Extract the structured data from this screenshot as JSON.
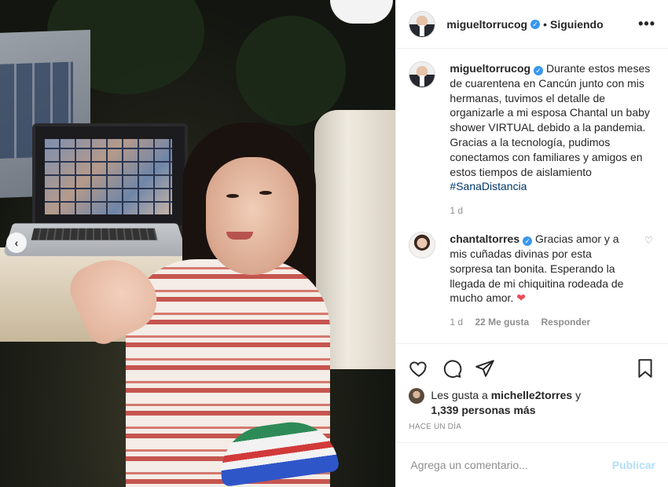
{
  "post": {
    "username": "migueltorrucog",
    "follow_status": "Siguiendo",
    "separator": "•",
    "more_icon": "•••"
  },
  "photo": {
    "prev_icon": "‹"
  },
  "caption": {
    "username": "migueltorrucog",
    "text": "Durante estos meses de cuarentena en Cancún junto con mis hermanas, tuvimos el detalle de organizarle a mi esposa Chantal un baby shower VIRTUAL debido a la pandemia. Gracias a la tecnología, pudimos conectamos con familiares y amigos en estos tiempos de aislamiento ",
    "hashtag": "#SanaDistancia",
    "time": "1 d"
  },
  "comment": {
    "username": "chantaltorres",
    "text": "Gracias amor y a mis cuñadas divinas por esta sorpresa tan bonita. Esperando la llegada de mi chiquitina rodeada de mucho amor. ",
    "emoji": "❤",
    "time": "1 d",
    "likes": "22 Me gusta",
    "reply": "Responder",
    "like_icon": "♡"
  },
  "likes": {
    "prefix": "Les gusta a ",
    "user": "michelle2torres",
    "middle": " y",
    "others": "1,339 personas más"
  },
  "timestamp": "HACE UN DÍA",
  "add_comment": {
    "placeholder": "Agrega un comentario...",
    "post_label": "Publicar"
  },
  "colors": {
    "link": "#00376b",
    "verified": "#3897f0",
    "muted": "#8e8e8e",
    "publish_disabled": "#b2dffc",
    "heart": "#ed4956"
  }
}
